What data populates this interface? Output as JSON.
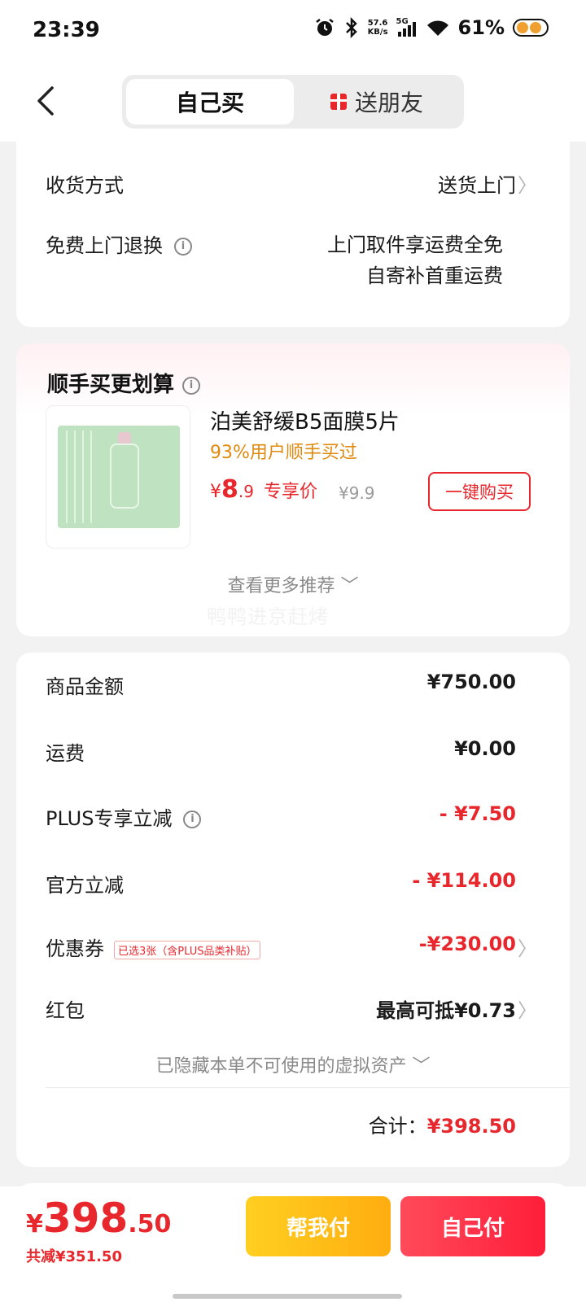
{
  "status_bar": {
    "time": "23:39",
    "net_speed_value": "57.6",
    "net_speed_unit": "KB/s",
    "network": "5G",
    "battery_percent": "61%",
    "icons": [
      "alarm-icon",
      "bluetooth-icon",
      "signal-icon",
      "wifi-icon",
      "battery-icon"
    ]
  },
  "header": {
    "tabs": [
      {
        "label": "自己买",
        "active": true
      },
      {
        "label": "送朋友",
        "active": false
      }
    ]
  },
  "delivery": {
    "method_label": "收货方式",
    "method_value": "送货上门",
    "return_label": "免费上门退换",
    "return_value_line1": "上门取件享运费全免",
    "return_value_line2": "自寄补首重运费"
  },
  "recommend": {
    "title": "顺手买更划算",
    "product_name": "泊美舒缓B5面膜5片",
    "product_tag": "93%用户顺手买过",
    "price_symbol": "¥",
    "price_int": "8",
    "price_dec": ".9",
    "price_label": "专享价",
    "original_price": "¥9.9",
    "buy_button": "一键购买",
    "more_link": "查看更多推荐",
    "watermark": "鸭鸭进京赶烤"
  },
  "summary": {
    "rows": [
      {
        "label": "商品金额",
        "value": "¥750.00"
      },
      {
        "label": "运费",
        "value": "¥0.00"
      },
      {
        "label": "PLUS专享立减",
        "value": "- ¥7.50"
      },
      {
        "label": "官方立减",
        "value": "- ¥114.00"
      },
      {
        "label": "优惠券",
        "value": "-¥230.00",
        "tag": "已选3张（含PLUS品类补贴）"
      },
      {
        "label": "红包",
        "value": "最高可抵¥0.73"
      }
    ],
    "hidden_assets": "已隐藏本单不可使用的虚拟资产",
    "total_label": "合计：",
    "total_value": "¥398.50"
  },
  "bottom_bar": {
    "price_symbol": "¥",
    "price_int": "398",
    "price_dec": ".50",
    "saved": "共减¥351.50",
    "help_pay_button": "帮我付",
    "self_pay_button": "自己付"
  },
  "colors": {
    "accent_red": "#e8272d",
    "orange_tag": "#e08a10",
    "help_button": "#ffbe18",
    "pay_button": "#ff2a44"
  }
}
